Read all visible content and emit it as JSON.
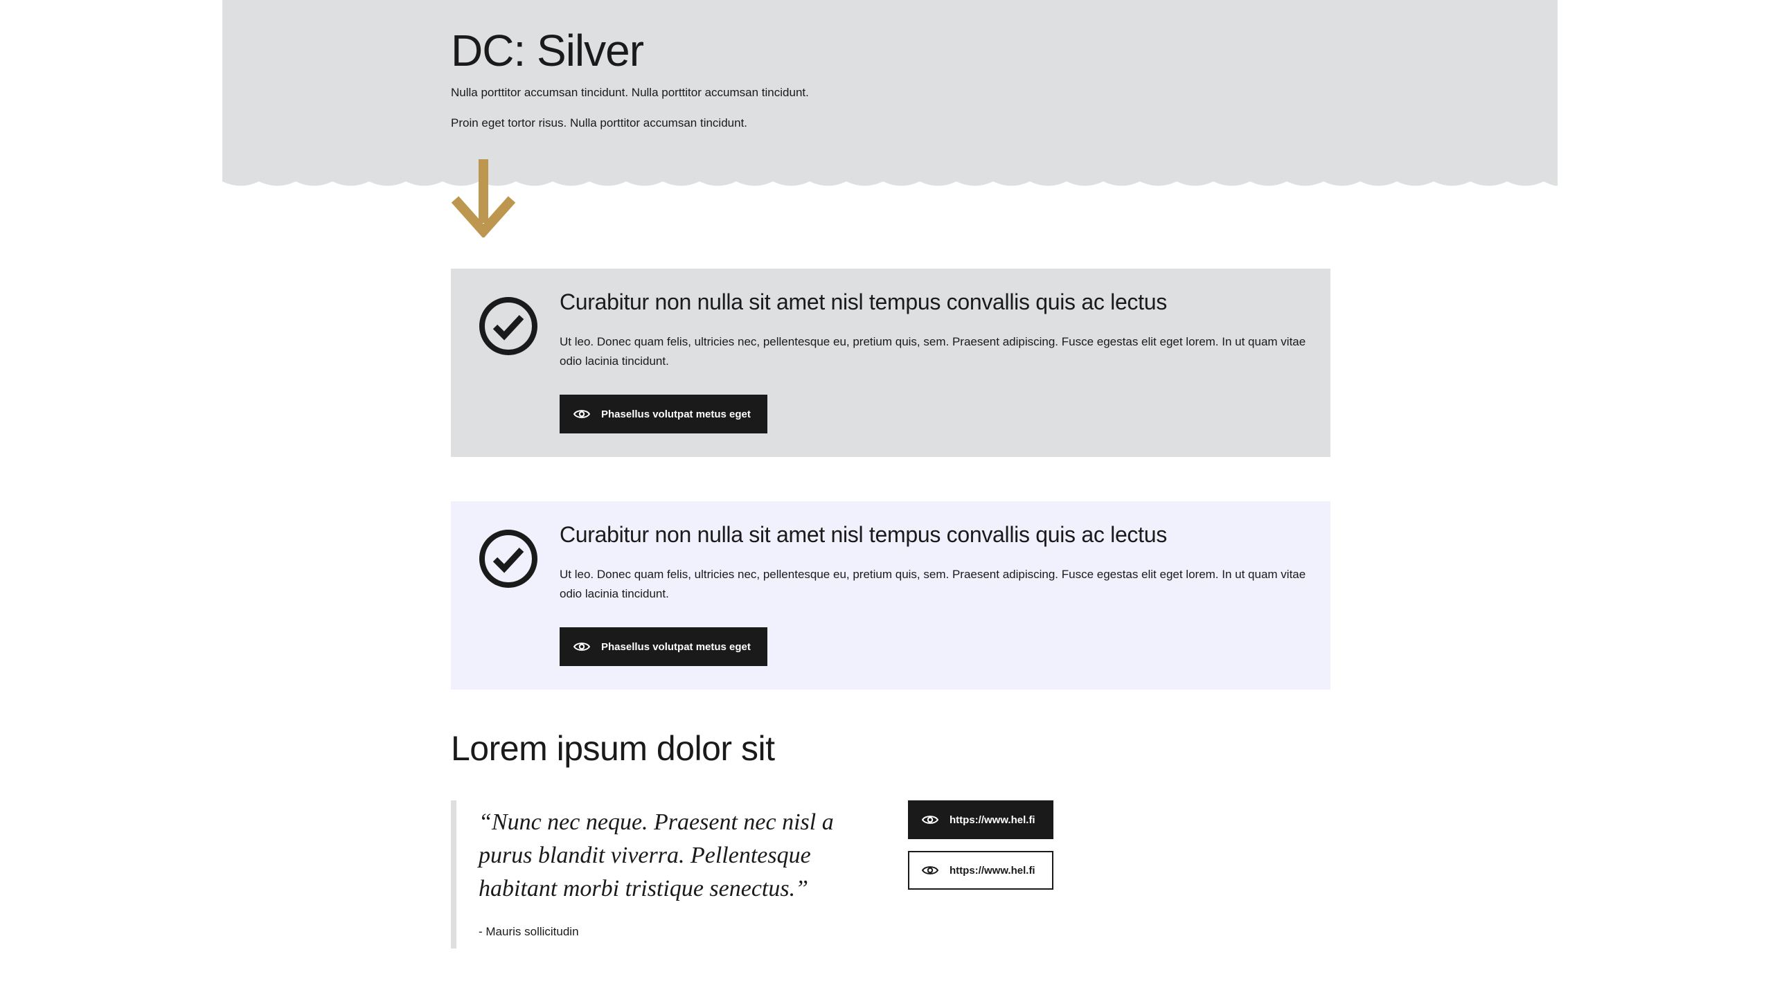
{
  "hero": {
    "title": "DC: Silver",
    "lead_1": "Nulla porttitor accumsan tincidunt. Nulla porttitor accumsan tincidunt.",
    "lead_2": "Proin eget tortor risus. Nulla porttitor accumsan tincidunt.",
    "background": "#dedfe1",
    "arrow_color": "#bd9650"
  },
  "cards": [
    {
      "title": "Curabitur non nulla sit amet nisl tempus convallis quis ac lectus",
      "description": "Ut leo. Donec quam felis, ultricies nec, pellentesque eu, pretium quis, sem. Praesent adipiscing. Fusce egestas elit eget lorem. In ut quam vitae odio lacinia tincidunt.",
      "button_label": "Phasellus volutpat metus eget",
      "background": "#dedfe1"
    },
    {
      "title": "Curabitur non nulla sit amet nisl tempus convallis quis ac lectus",
      "description": "Ut leo. Donec quam felis, ultricies nec, pellentesque eu, pretium quis, sem. Praesent adipiscing. Fusce egestas elit eget lorem. In ut quam vitae odio lacinia tincidunt.",
      "button_label": "Phasellus volutpat metus eget",
      "background": "#f1f0fd"
    }
  ],
  "section": {
    "title": "Lorem ipsum dolor sit"
  },
  "quote": {
    "text": "“Nunc nec neque. Praesent nec nisl a purus blandit viverra. Pellentesque habitant morbi tristique senectus.”",
    "author": "- Mauris sollicitudin"
  },
  "links": [
    {
      "label": "https://www.hel.fi",
      "style": "dark"
    },
    {
      "label": "https://www.hel.fi",
      "style": "light"
    }
  ],
  "icons": {
    "arrow": "arrow-down-icon",
    "check": "check-circle-icon",
    "eye": "eye-icon"
  }
}
